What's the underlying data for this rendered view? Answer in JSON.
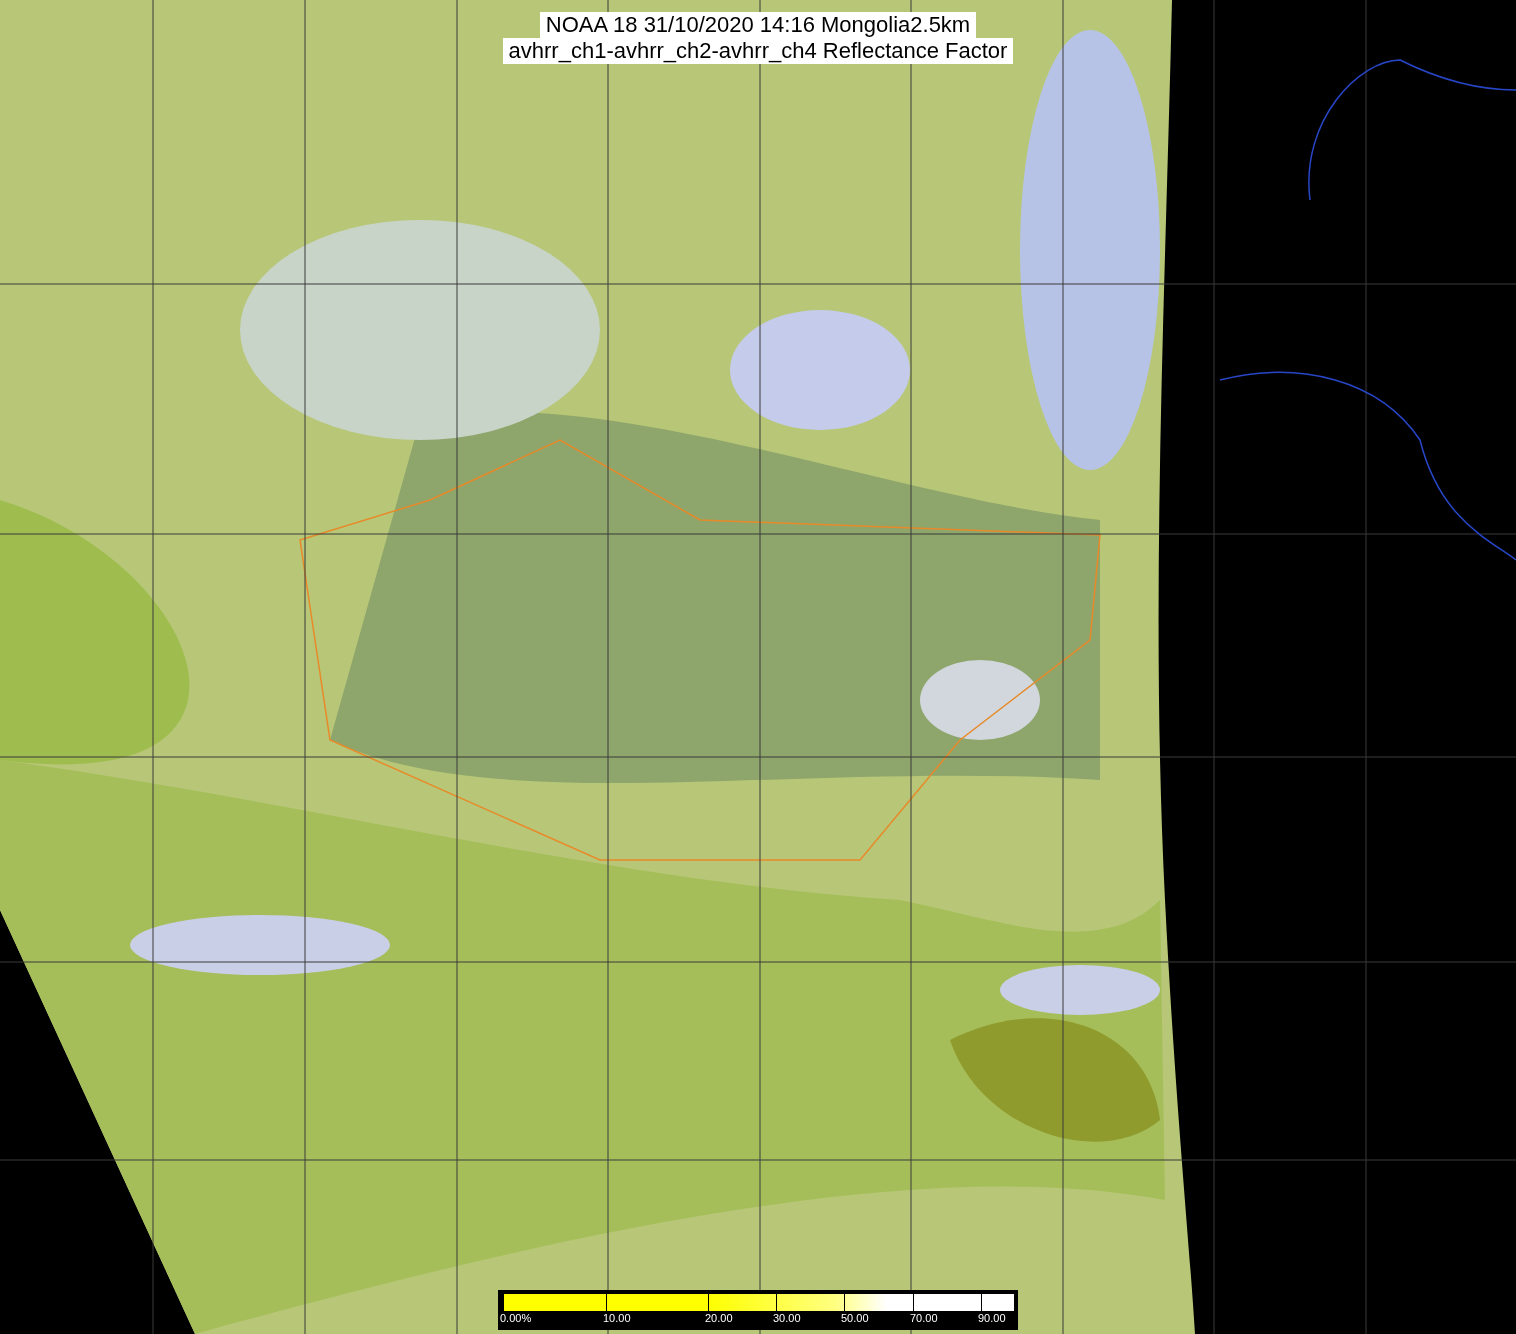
{
  "title": {
    "lines": [
      "NOAA 18 31/10/2020 14:16 Mongolia2.5km",
      "avhrr_ch1-avhrr_ch2-avhrr_ch4 Reflectance Factor"
    ]
  },
  "legend": {
    "ticks": [
      "0.00%",
      "10.00",
      "20.00",
      "30.00",
      "50.00",
      "70.00",
      "90.00"
    ]
  }
}
